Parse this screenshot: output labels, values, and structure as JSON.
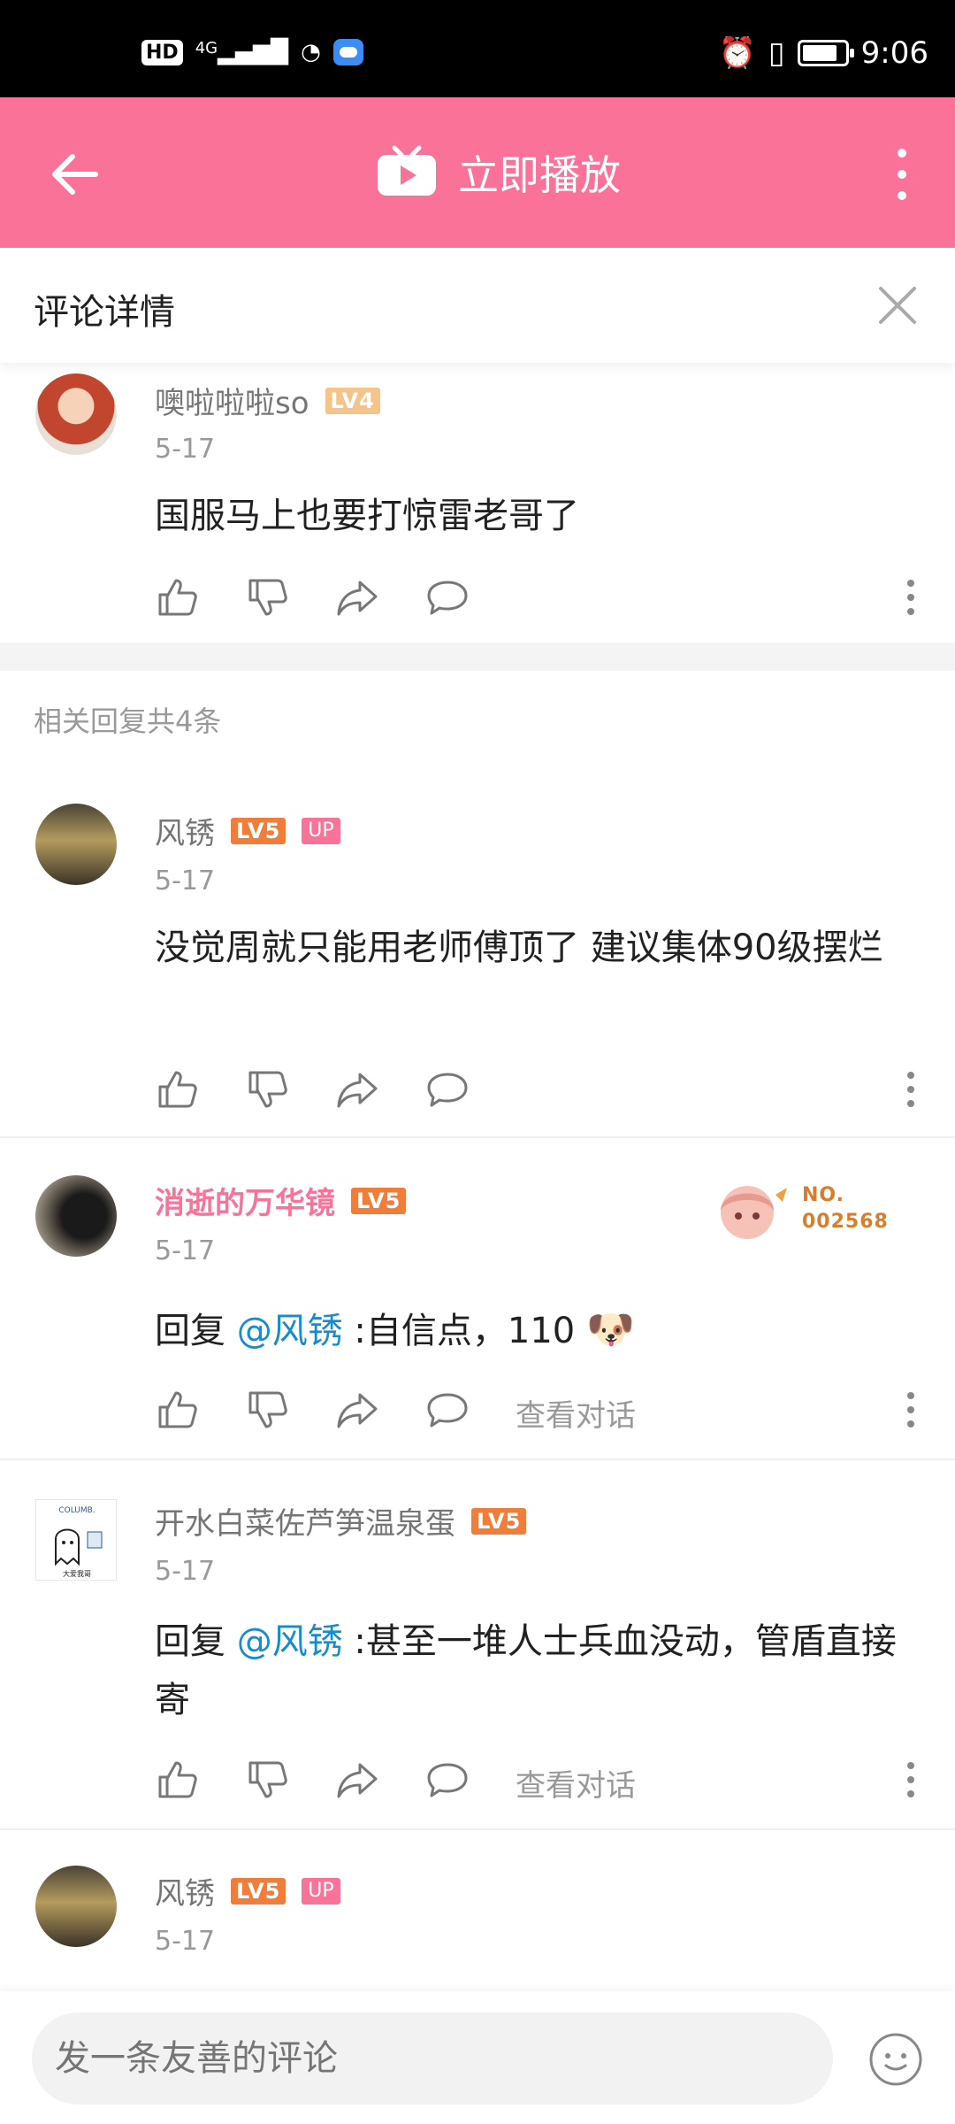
{
  "status_bar": {
    "hd": "HD",
    "network": "4G",
    "time": "9:06"
  },
  "header": {
    "play_label": "立即播放"
  },
  "detail": {
    "title": "评论详情"
  },
  "root_comment": {
    "user": "噢啦啦啦so",
    "level": "LV4",
    "date": "5-17",
    "text": "国服马上也要打惊雷老哥了"
  },
  "related_count": "相关回复共4条",
  "replies": [
    {
      "user": "风锈",
      "level": "LV5",
      "badge": "UP",
      "date": "5-17",
      "text": "没觉周就只能用老师傅顶了 建议集体90级摆烂"
    },
    {
      "user": "消逝的万华镜",
      "level": "LV5",
      "date": "5-17",
      "prefix": "回复 ",
      "mention": "@风锈",
      "text": " :自信点，110",
      "emoji": "🐶",
      "fan_no": "NO.",
      "fan_id": "002568",
      "view_conv": "查看对话"
    },
    {
      "user": "开水白菜佐芦笋温泉蛋",
      "level": "LV5",
      "date": "5-17",
      "prefix": "回复 ",
      "mention": "@风锈",
      "text": " :甚至一堆人士兵血没动，管盾直接寄",
      "view_conv": "查看对话"
    },
    {
      "user": "风锈",
      "level": "LV5",
      "badge": "UP",
      "date": "5-17"
    }
  ],
  "input": {
    "placeholder": "发一条友善的评论"
  },
  "colors": {
    "brand_pink": "#fb7299",
    "mention_blue": "#178bcf",
    "lv5_orange": "#f07d3a",
    "lv4_orange": "#f5c48a"
  }
}
